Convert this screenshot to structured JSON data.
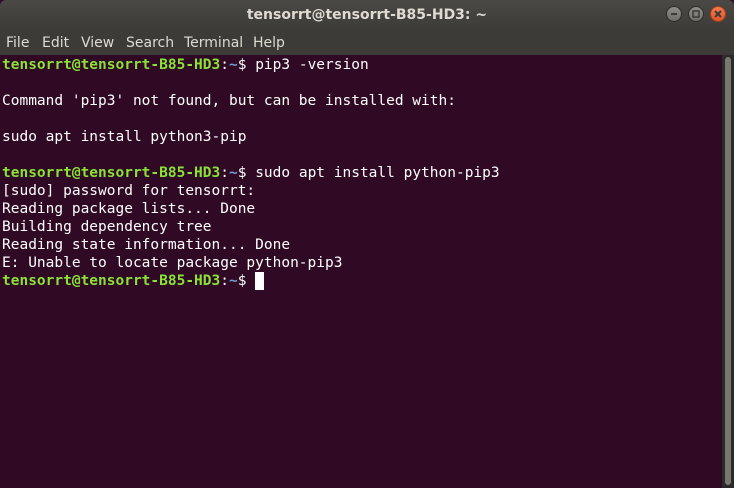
{
  "window": {
    "title": "tensorrt@tensorrt-B85-HD3: ~",
    "buttons": [
      "minimize",
      "maximize",
      "close"
    ]
  },
  "menu": {
    "file": "File",
    "edit": "Edit",
    "view": "View",
    "search": "Search",
    "terminal": "Terminal",
    "help": "Help"
  },
  "terminal": {
    "prompt_user": "tensorrt@tensorrt-B85-HD3",
    "prompt_colon": ":",
    "prompt_path": "~",
    "prompt_dollar": "$ ",
    "cmd1": "pip3 -version",
    "out1": "Command 'pip3' not found, but can be installed with:",
    "out2": "sudo apt install python3-pip",
    "cmd2": "sudo apt install python-pip3",
    "out3": "[sudo] password for tensorrt:",
    "out4": "Reading package lists... Done",
    "out5": "Building dependency tree",
    "out6": "Reading state information... Done",
    "out7": "E: Unable to locate package python-pip3"
  },
  "colors": {
    "terminal_bg": "#300a24",
    "prompt_user": "#8ae234",
    "prompt_path": "#729fcf",
    "text": "#ffffff"
  }
}
